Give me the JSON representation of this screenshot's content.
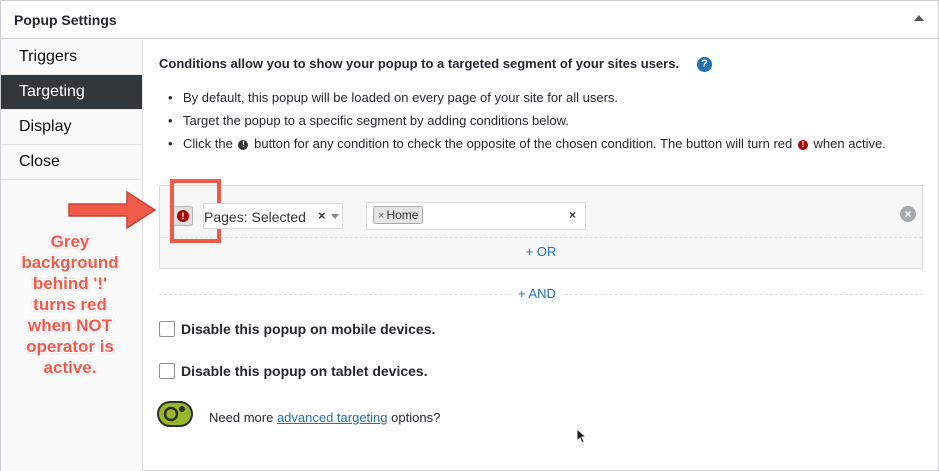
{
  "panel": {
    "title": "Popup Settings"
  },
  "tabs": [
    {
      "label": "Triggers"
    },
    {
      "label": "Targeting"
    },
    {
      "label": "Display"
    },
    {
      "label": "Close"
    }
  ],
  "targeting": {
    "intro": "Conditions allow you to show your popup to a targeted segment of your sites users.",
    "help_icon": "?",
    "bullets": [
      "By default, this popup will be loaded on every page of your site for all users.",
      "Target the popup to a specific segment by adding conditions below."
    ],
    "bullet3_part1": "Click the",
    "bullet3_part2": "button for any condition to check the opposite of the chosen condition. The button will turn red",
    "bullet3_part3": "when active.",
    "condition": {
      "not_icon": "!",
      "rule_label": "Pages: Selected",
      "rule_clear": "×",
      "tag": "Home",
      "tag_remove": "×",
      "tags_clear": "×",
      "remove_icon": "×"
    },
    "or_label": "+ OR",
    "and_label": "+ AND",
    "mobile_label": "Disable this popup on mobile devices.",
    "tablet_label": "Disable this popup on tablet devices.",
    "promo": {
      "prefix": "Need more",
      "link": "advanced targeting",
      "suffix": "options?"
    }
  },
  "annotation": {
    "text": "Grey background behind '!' turns red when NOT operator is active.",
    "color": "#f6574a"
  },
  "colors": {
    "accent": "#2271b1",
    "active_tab": "#32373c",
    "not_active": "#aa0000",
    "highlight": "#f05a48"
  }
}
